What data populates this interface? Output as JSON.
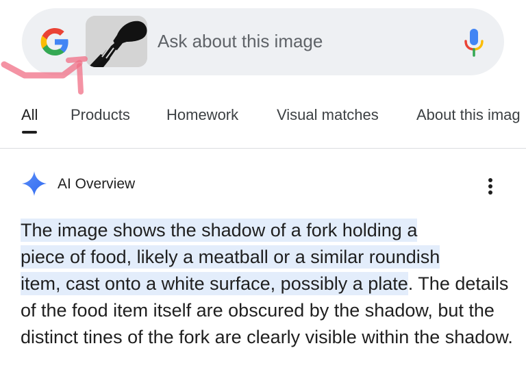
{
  "search": {
    "placeholder": "Ask about this image"
  },
  "tabs": [
    {
      "label": "All",
      "active": true
    },
    {
      "label": "Products",
      "active": false
    },
    {
      "label": "Homework",
      "active": false
    },
    {
      "label": "Visual matches",
      "active": false
    },
    {
      "label": "About this imag",
      "active": false
    }
  ],
  "overview": {
    "title": "AI Overview",
    "highlighted_lines": [
      "The image shows the shadow of a fork holding a",
      "piece of food, likely a meatball or a similar roundish",
      "item, cast onto a white surface, possibly a plate"
    ],
    "continuation": ". The details of the food item itself are obscured by the shadow, but the distinct tines of the fork are clearly visible within the shadow."
  },
  "icons": {
    "logo": "google-g-icon",
    "mic": "microphone-icon",
    "sparkle": "gemini-sparkle-icon",
    "menu": "more-vert-icon"
  },
  "colors": {
    "search_bg": "#eef0f3",
    "highlight": "#e3edfb",
    "sparkle": "#4a7cf7",
    "annotation": "#f06f86"
  }
}
